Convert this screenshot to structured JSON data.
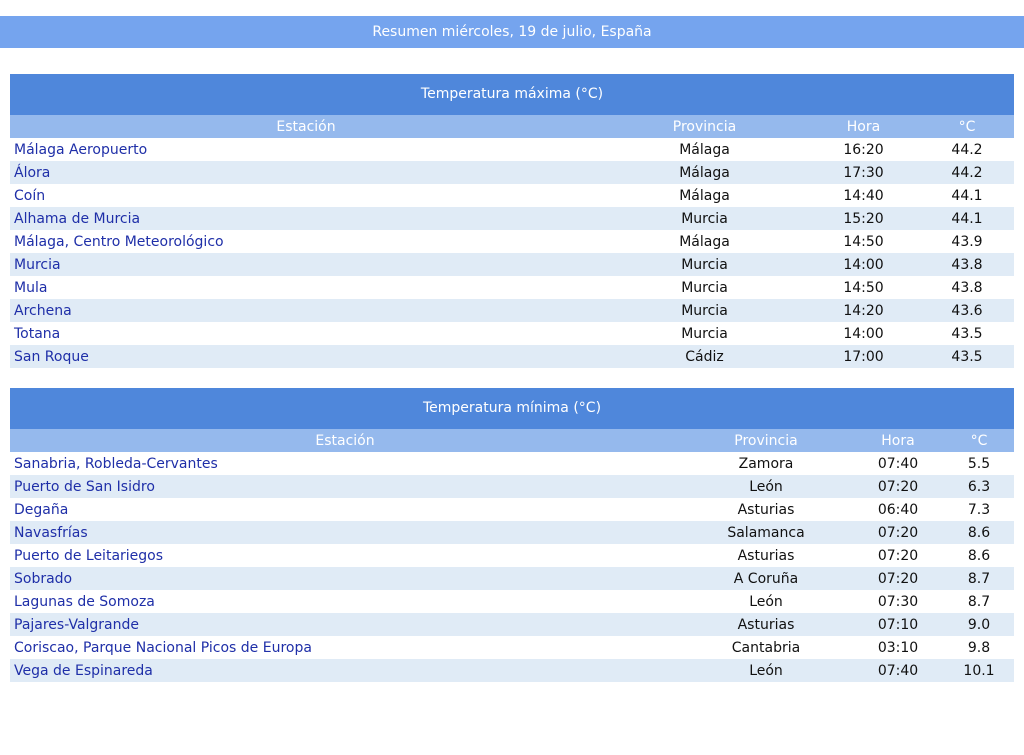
{
  "header": {
    "title": "Resumen miércoles, 19 de julio, España"
  },
  "max_table": {
    "title": "Temperatura máxima (°C)",
    "columns": [
      "Estación",
      "Provincia",
      "Hora",
      "°C"
    ],
    "rows": [
      {
        "station": "Málaga Aeropuerto",
        "province": "Málaga",
        "time": "16:20",
        "value": "44.2"
      },
      {
        "station": "Álora",
        "province": "Málaga",
        "time": "17:30",
        "value": "44.2"
      },
      {
        "station": "Coín",
        "province": "Málaga",
        "time": "14:40",
        "value": "44.1"
      },
      {
        "station": "Alhama de Murcia",
        "province": "Murcia",
        "time": "15:20",
        "value": "44.1"
      },
      {
        "station": "Málaga, Centro Meteorológico",
        "province": "Málaga",
        "time": "14:50",
        "value": "43.9"
      },
      {
        "station": "Murcia",
        "province": "Murcia",
        "time": "14:00",
        "value": "43.8"
      },
      {
        "station": "Mula",
        "province": "Murcia",
        "time": "14:50",
        "value": "43.8"
      },
      {
        "station": "Archena",
        "province": "Murcia",
        "time": "14:20",
        "value": "43.6"
      },
      {
        "station": "Totana",
        "province": "Murcia",
        "time": "14:00",
        "value": "43.5"
      },
      {
        "station": "San Roque",
        "province": "Cádiz",
        "time": "17:00",
        "value": "43.5"
      }
    ]
  },
  "min_table": {
    "title": "Temperatura mínima (°C)",
    "columns": [
      "Estación",
      "Provincia",
      "Hora",
      "°C"
    ],
    "rows": [
      {
        "station": "Sanabria, Robleda-Cervantes",
        "province": "Zamora",
        "time": "07:40",
        "value": "5.5"
      },
      {
        "station": "Puerto de San Isidro",
        "province": "León",
        "time": "07:20",
        "value": "6.3"
      },
      {
        "station": "Degaña",
        "province": "Asturias",
        "time": "06:40",
        "value": "7.3"
      },
      {
        "station": "Navasfrías",
        "province": "Salamanca",
        "time": "07:20",
        "value": "8.6"
      },
      {
        "station": "Puerto de Leitariegos",
        "province": "Asturias",
        "time": "07:20",
        "value": "8.6"
      },
      {
        "station": "Sobrado",
        "province": "A Coruña",
        "time": "07:20",
        "value": "8.7"
      },
      {
        "station": "Lagunas de Somoza",
        "province": "León",
        "time": "07:30",
        "value": "8.7"
      },
      {
        "station": "Pajares-Valgrande",
        "province": "Asturias",
        "time": "07:10",
        "value": "9.0"
      },
      {
        "station": "Coriscao, Parque Nacional Picos de Europa",
        "province": "Cantabria",
        "time": "03:10",
        "value": "9.8"
      },
      {
        "station": "Vega de Espinareda",
        "province": "León",
        "time": "07:40",
        "value": "10.1"
      }
    ]
  }
}
